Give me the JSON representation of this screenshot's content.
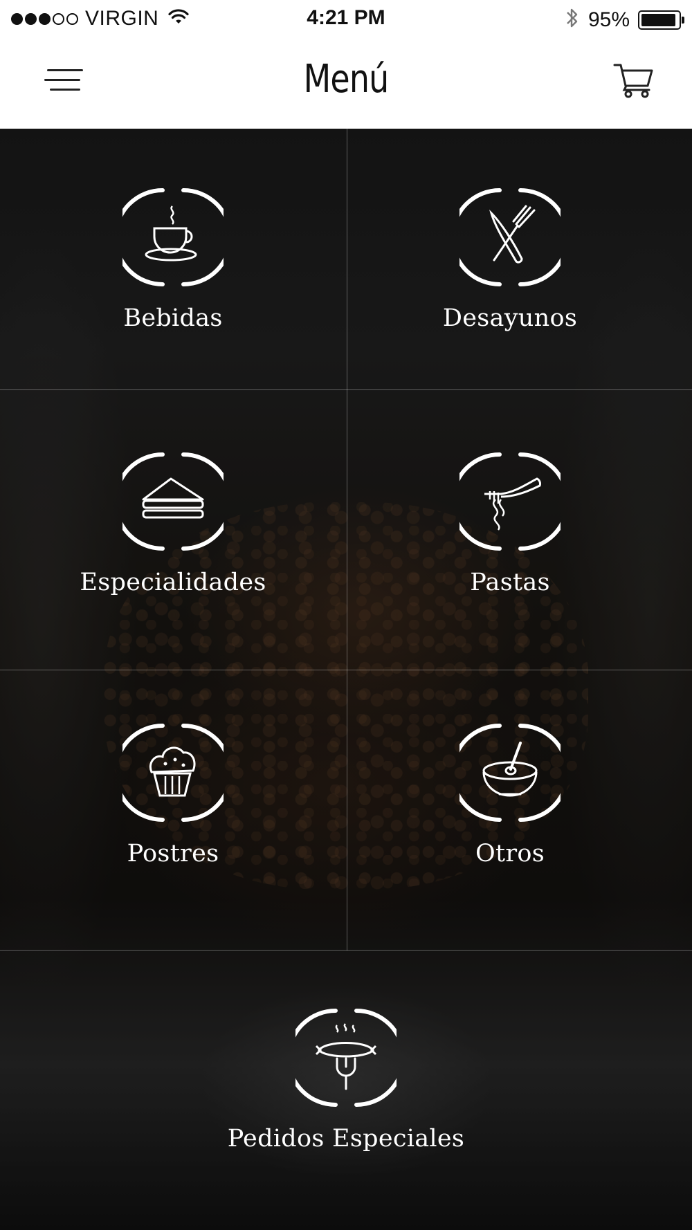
{
  "status_bar": {
    "carrier": "VIRGIN",
    "signal_bars_filled": 3,
    "signal_bars_total": 5,
    "time": "4:21 PM",
    "battery_percent": "95%",
    "icons": [
      "wifi-icon",
      "bluetooth-icon",
      "battery-icon"
    ]
  },
  "nav": {
    "title": "Menú",
    "left_icon": "hamburger-menu-icon",
    "right_icon": "cart-icon"
  },
  "categories": [
    {
      "label": "Bebidas",
      "icon": "coffee-cup-icon"
    },
    {
      "label": "Desayunos",
      "icon": "fork-knife-icon"
    },
    {
      "label": "Especialidades",
      "icon": "sandwich-icon"
    },
    {
      "label": "Pastas",
      "icon": "pasta-icon"
    },
    {
      "label": "Postres",
      "icon": "muffin-icon"
    },
    {
      "label": "Otros",
      "icon": "bowl-icon"
    },
    {
      "label": "Pedidos Especiales",
      "icon": "sausage-grill-icon"
    }
  ],
  "colors": {
    "text_on_photo": "#ffffff",
    "nav_background": "#ffffff",
    "grid_lines": "rgba(255,255,255,0.32)"
  }
}
